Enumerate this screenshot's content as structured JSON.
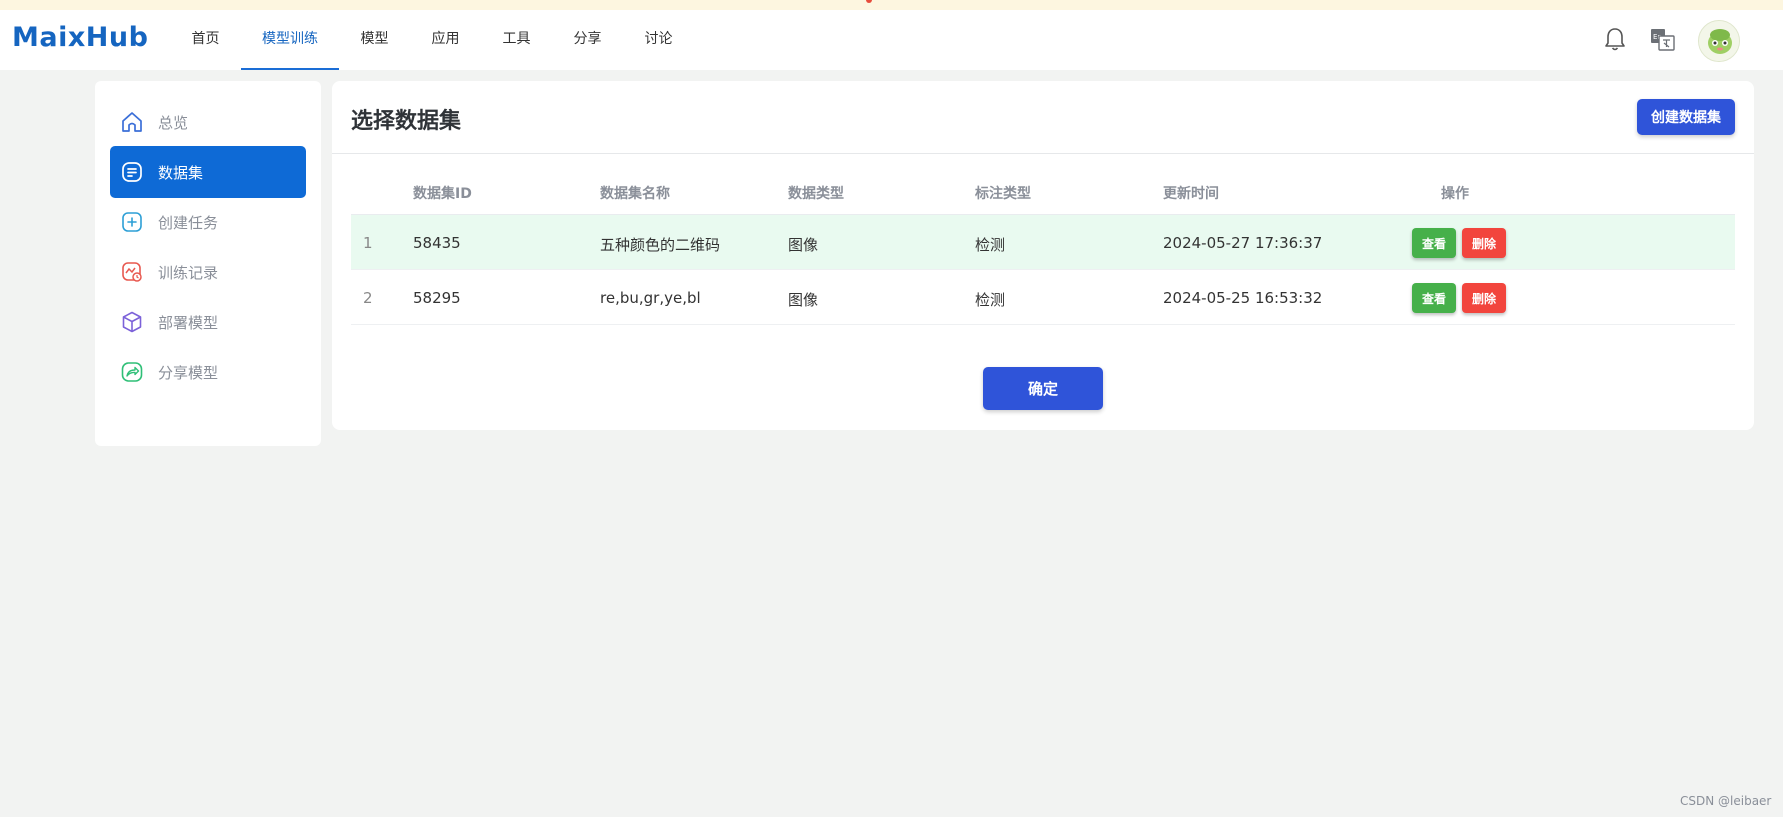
{
  "header": {
    "logo": "MaixHub",
    "nav": [
      {
        "label": "首页"
      },
      {
        "label": "模型训练",
        "active": true
      },
      {
        "label": "模型"
      },
      {
        "label": "应用"
      },
      {
        "label": "工具"
      },
      {
        "label": "分享"
      },
      {
        "label": "讨论"
      }
    ],
    "icons": [
      "bell-icon",
      "language-icon",
      "user-avatar"
    ]
  },
  "sidebar": {
    "items": [
      {
        "label": "总览",
        "icon": "home-icon"
      },
      {
        "label": "数据集",
        "icon": "dataset-icon",
        "active": true
      },
      {
        "label": "创建任务",
        "icon": "plus-icon"
      },
      {
        "label": "训练记录",
        "icon": "record-icon"
      },
      {
        "label": "部署模型",
        "icon": "cube-icon"
      },
      {
        "label": "分享模型",
        "icon": "share-icon"
      }
    ]
  },
  "main": {
    "title": "选择数据集",
    "create_button": "创建数据集",
    "table": {
      "columns": [
        "数据集ID",
        "数据集名称",
        "数据类型",
        "标注类型",
        "更新时间",
        "操作"
      ],
      "rows": [
        {
          "index": "1",
          "id": "58435",
          "name": "五种颜色的二维码",
          "data_type": "图像",
          "label_type": "检测",
          "updated": "2024-05-27 17:36:37",
          "selected": true
        },
        {
          "index": "2",
          "id": "58295",
          "name": "re,bu,gr,ye,bl",
          "data_type": "图像",
          "label_type": "检测",
          "updated": "2024-05-25 16:53:32",
          "selected": false
        }
      ],
      "view_label": "查看",
      "delete_label": "删除"
    },
    "confirm_button": "确定"
  },
  "watermark": "CSDN @leibaer",
  "colors": {
    "brand": "#1565c0",
    "primary_button": "#2f54d9",
    "sidebar_active": "#0e6ad6",
    "view_button": "#46b04a",
    "delete_button": "#f2453d",
    "selected_row": "#e9faf0"
  }
}
